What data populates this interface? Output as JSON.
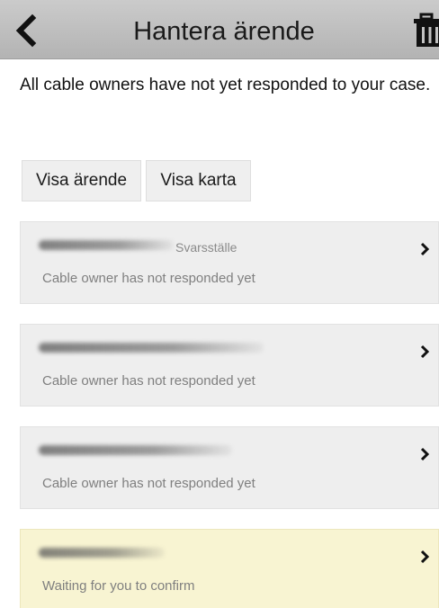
{
  "header": {
    "title": "Hantera ärende",
    "back_icon": "chevron-left-icon",
    "delete_icon": "trash-icon"
  },
  "message": "All cable owners have not yet responded to your case.",
  "tabs": [
    {
      "label": "Visa ärende"
    },
    {
      "label": "Visa karta"
    }
  ],
  "owners": [
    {
      "name_suffix": "Svarsställe",
      "status": "Cable owner has not responded yet",
      "state": "not-responded"
    },
    {
      "name_suffix": "",
      "status": "Cable owner has not responded yet",
      "state": "not-responded"
    },
    {
      "name_suffix": "",
      "status": "Cable owner has not responded yet",
      "state": "not-responded"
    },
    {
      "name_suffix": "",
      "status": "Waiting for you to confirm",
      "state": "awaiting-confirmation"
    }
  ],
  "colors": {
    "header_bg": "#c2c2c2",
    "card_bg": "#eeeeee",
    "pending_card_bg": "#f8f4d2",
    "status_text": "#7f7f7f"
  }
}
